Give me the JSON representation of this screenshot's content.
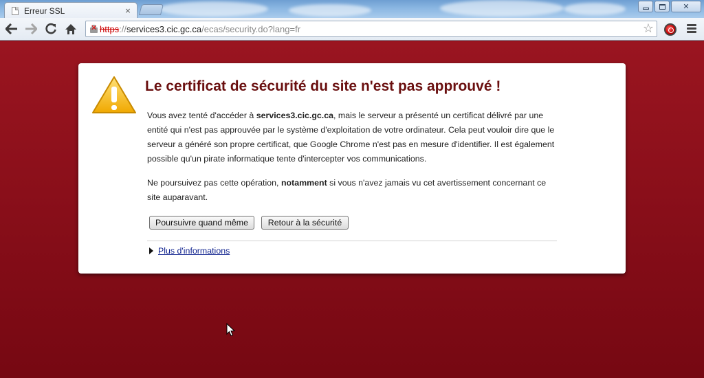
{
  "window": {
    "tab_title": "Erreur SSL",
    "tab_close": "×",
    "min_icon": "minimize-icon",
    "max_icon": "restore-icon",
    "close_glyph": "✕"
  },
  "toolbar": {
    "url_scheme": "https",
    "url_sep": "://",
    "url_host": "services3.cic.gc.ca",
    "url_path": "/ecas/security.do?lang=fr",
    "back_glyph": "🡐",
    "forward_glyph": "🡒",
    "reload_glyph": "↻",
    "home_glyph": "⌂",
    "star_glyph": "☆"
  },
  "error": {
    "title": "Le certificat de sécurité du site n'est pas approuvé !",
    "p1_before": "Vous avez tenté d'accéder à ",
    "p1_host": "services3.cic.gc.ca",
    "p1_after": ", mais le serveur a présenté un certificat délivré par une entité qui n'est pas approuvée par le système d'exploitation de votre ordinateur. Cela peut vouloir dire que le serveur a généré son propre certificat, que Google Chrome n'est pas en mesure d'identifier. Il est également possible qu'un pirate informatique tente d'intercepter vos communications.",
    "p2_before": "Ne poursuivez pas cette opération, ",
    "p2_bold": "notamment",
    "p2_after": " si vous n'avez jamais vu cet avertissement concernant ce site auparavant.",
    "proceed_label": "Poursuivre quand même",
    "back_label": "Retour à la sécurité",
    "more_info_label": "Plus d'informations"
  },
  "colors": {
    "page_background": "#8a0f1a",
    "title_color": "#6a0f0f",
    "link_color": "#0b1e8c",
    "insecure_scheme": "#cc0000"
  }
}
